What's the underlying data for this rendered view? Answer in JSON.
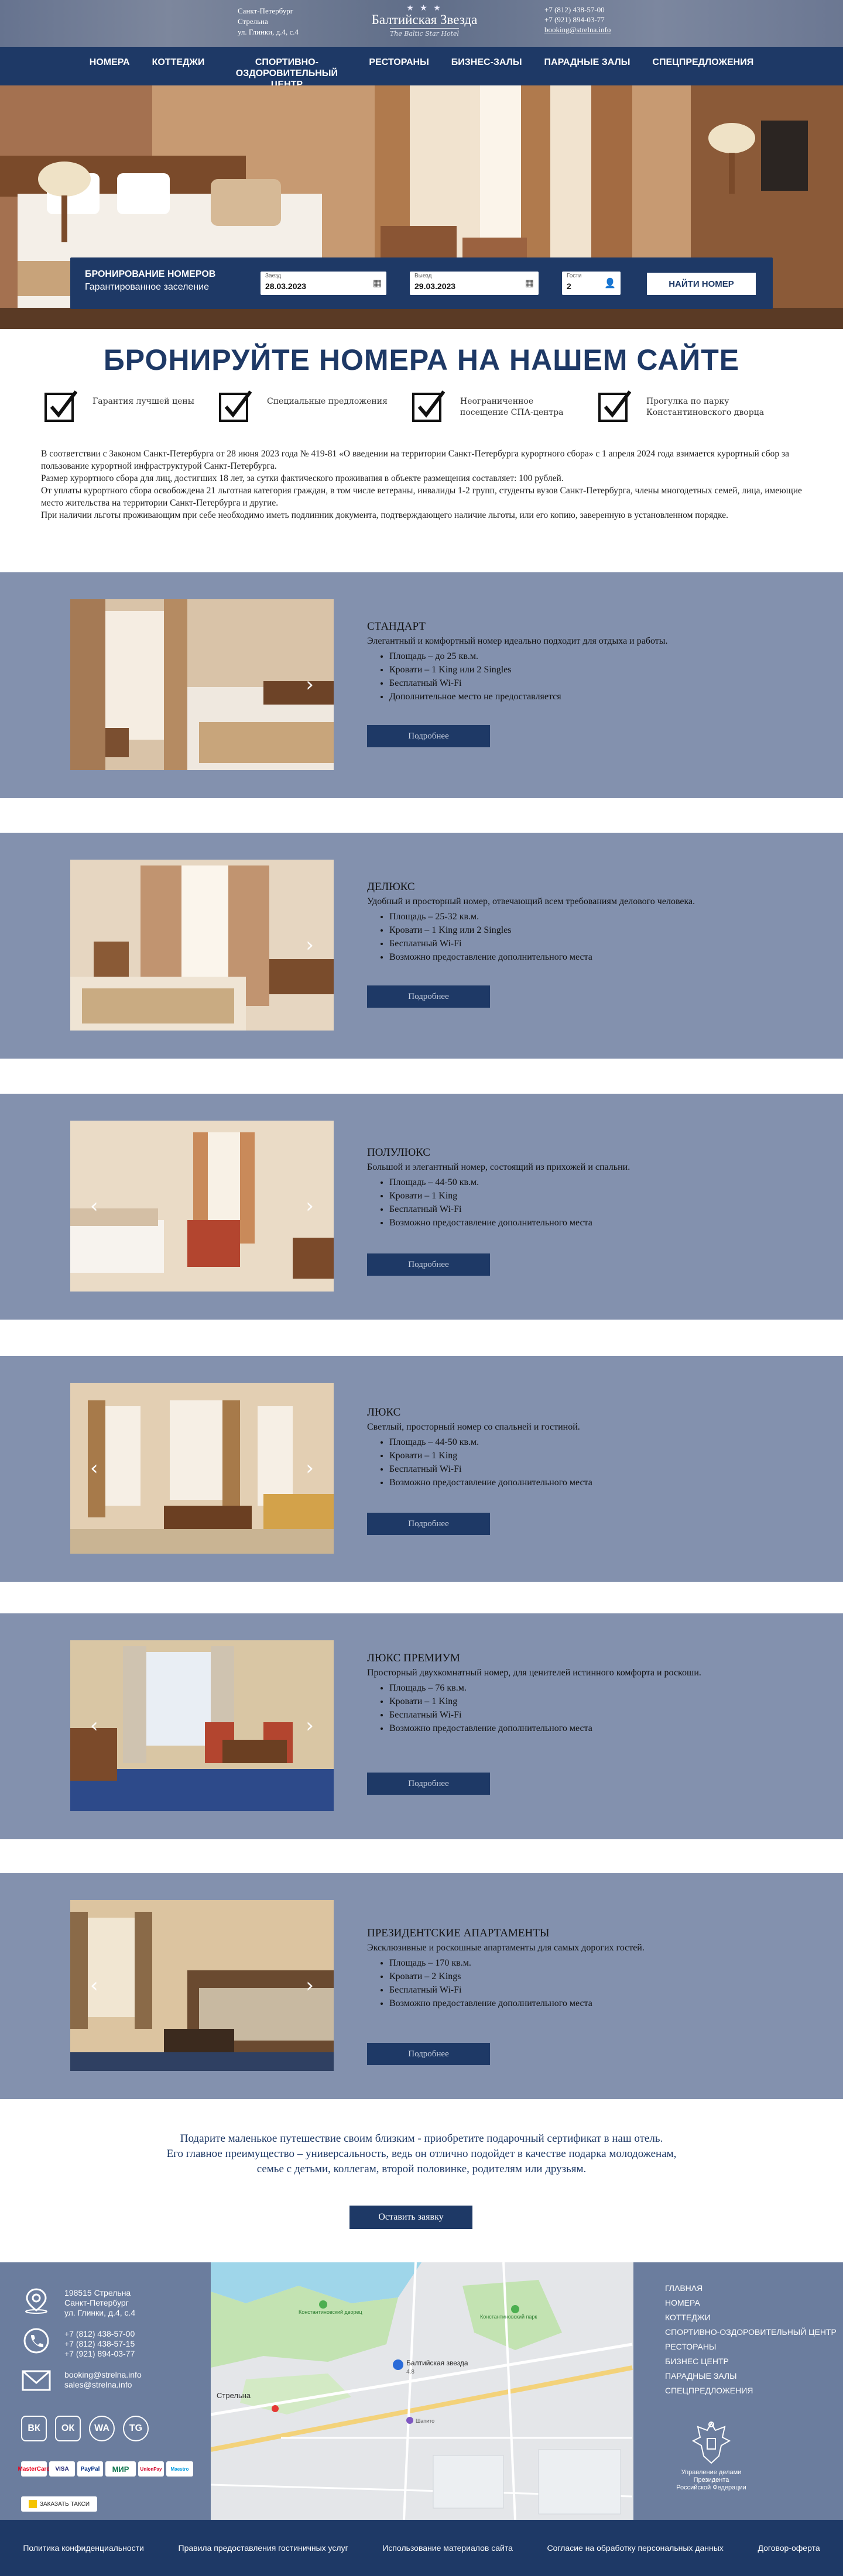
{
  "topbar": {
    "address_lines": [
      "Санкт-Петербург",
      "Стрельна",
      "ул. Глинки, д.4, с.4"
    ],
    "logo_name": "Балтийская Звезда",
    "logo_sub": "The Baltic Star Hotel",
    "phones": [
      "+7 (812) 438-57-00",
      "+7 (921) 894-03-77"
    ],
    "email": "booking@strelna.info"
  },
  "nav": {
    "items": [
      "НОМЕРА",
      "КОТТЕДЖИ",
      "СПОРТИВНО-ОЗДОРОВИТЕЛЬНЫЙ ЦЕНТР",
      "РЕСТОРАНЫ",
      "БИЗНЕС-ЗАЛЫ",
      "ПАРАДНЫЕ ЗАЛЫ",
      "СПЕЦПРЕДЛОЖЕНИЯ"
    ]
  },
  "booking": {
    "title": "БРОНИРОВАНИЕ НОМЕРОВ",
    "subtitle": "Гарантированное заселение",
    "checkin_label": "Заезд",
    "checkin_value": "28.03.2023",
    "checkout_label": "Выезд",
    "checkout_value": "29.03.2023",
    "guests_label": "Гости",
    "guests_value": "2",
    "button": "НАЙТИ НОМЕР"
  },
  "main": {
    "heading": "БРОНИРУЙТЕ НОМЕРА НА НАШЕМ САЙТЕ",
    "features": [
      {
        "label": "Гарантия лучшей цены"
      },
      {
        "label": "Специальные предложения"
      },
      {
        "label": "Неограниченное посещение СПА-центра"
      },
      {
        "label": "Прогулка по парку Константиновского дворца"
      }
    ],
    "notice": [
      "В соответствии с Законом Санкт-Петербурга от 28 июня 2023 года № 419-81 «О введении на территории Санкт-Петербурга курортного сбора» с 1 апреля 2024 года взимается курортный сбор за пользование курортной инфраструктурой Санкт-Петербурга.",
      "Размер курортного сбора для лиц, достигших 18 лет, за сутки фактического проживания в объекте размещения составляет: 100 рублей.",
      "От уплаты курортного сбора освобождена 21 льготная категория граждан, в том числе ветераны, инвалиды 1-2 групп, студенты вузов Санкт-Петербурга, члены многодетных семей, лица, имеющие место жительства на территории Санкт-Петербурга и другие.",
      "При наличии льготы проживающим при себе необходимо иметь подлинник документа, подтверждающего наличие льготы, или его копию, заверенную в установленном порядке."
    ]
  },
  "rooms": [
    {
      "title": "СТАНДАРТ",
      "desc": "Элегантный и комфортный номер идеально подходит для отдыха и работы.",
      "features": [
        "Площадь – до 25 кв.м.",
        "Кровати – 1 King или 2 Singles",
        "Бесплатный Wi-Fi",
        "Дополнительное место не предоставляется"
      ],
      "button": "Подробнее"
    },
    {
      "title": "ДЕЛЮКС",
      "desc": "Удобный и просторный номер, отвечающий всем требованиям делового человека.",
      "features": [
        "Площадь – 25-32 кв.м.",
        "Кровати – 1 King или 2 Singles",
        "Бесплатный Wi-Fi",
        "Возможно предоставление дополнительного места"
      ],
      "button": "Подробнее"
    },
    {
      "title": "ПОЛУЛЮКС",
      "desc": "Большой и элегантный номер, состоящий из прихожей и спальни.",
      "features": [
        "Площадь – 44-50 кв.м.",
        "Кровати – 1 King",
        "Бесплатный Wi-Fi",
        "Возможно предоставление дополнительного места"
      ],
      "button": "Подробнее"
    },
    {
      "title": "ЛЮКС",
      "desc": "Светлый, просторный номер со спальней и гостиной.",
      "features": [
        "Площадь – 44-50 кв.м.",
        "Кровати – 1 King",
        "Бесплатный Wi-Fi",
        "Возможно предоставление дополнительного места"
      ],
      "button": "Подробнее"
    },
    {
      "title": "ЛЮКС ПРЕМИУМ",
      "desc": "Просторный двухкомнатный номер, для ценителей истинного комфорта и роскоши.",
      "features": [
        "Площадь – 76 кв.м.",
        "Кровати – 1 King",
        "Бесплатный Wi-Fi",
        "Возможно предоставление дополнительного места"
      ],
      "button": "Подробнее"
    },
    {
      "title": "ПРЕЗИДЕНТСКИЕ АПАРТАМЕНТЫ",
      "desc": "Эксклюзивные и роскошные апартаменты для самых дорогих гостей.",
      "features": [
        "Площадь – 170 кв.м.",
        "Кровати – 2 Kings",
        "Бесплатный Wi-Fi",
        "Возможно предоставление дополнительного места"
      ],
      "button": "Подробнее"
    }
  ],
  "gift": {
    "line1": "Подарите маленькое путешествие своим близким - приобретите подарочный сертификат в наш отель.",
    "line2": "Его главное преимущество – универсальность, ведь он отлично подойдет в качестве подарка молодоженам,",
    "line3": "семье с детьми, коллегам, второй половинке, родителям или друзьям.",
    "button": "Оставить заявку"
  },
  "footer": {
    "address": [
      "198515 Стрельна",
      "Санкт-Петербург",
      "ул. Глинки, д.4, с.4"
    ],
    "phones": [
      "+7 (812) 438-57-00",
      "+7 (812) 438-57-15",
      "+7 (921) 894-03-77"
    ],
    "emails": [
      "booking@strelna.info",
      "sales@strelna.info"
    ],
    "social": [
      "ВК",
      "ОК",
      "WA",
      "TG"
    ],
    "payments": [
      "MasterCard",
      "VISA",
      "PayPal",
      "МИР",
      "UnionPay",
      "Maestro"
    ],
    "taxi": "ЗАКАЗАТЬ ТАКСИ",
    "nav": [
      "ГЛАВНАЯ",
      "НОМЕРА",
      "КОТТЕДЖИ",
      "СПОРТИВНО-ОЗДОРОВИТЕЛЬНЫЙ ЦЕНТР",
      "РЕСТОРАНЫ",
      "БИЗНЕС ЦЕНТР",
      "ПАРАДНЫЕ ЗАЛЫ",
      "СПЕЦПРЕДЛОЖЕНИЯ"
    ],
    "emblem": [
      "Управление делами",
      "Президента",
      "Российской Федерации"
    ],
    "map_labels": {
      "hotel": "Балтийская звезда",
      "hotel_rating": "4.8",
      "town": "Стрельна",
      "park": "Константиновский дворец",
      "place2": "Константиновский парк",
      "place3": "Шапито"
    }
  },
  "bottom_links": [
    "Политика конфиденциальности",
    "Правила предоставления гостиничных услуг",
    "Использование материалов сайта",
    "Согласие на обработку персональных данных",
    "Договор-оферта"
  ],
  "colors": {
    "brand": "#1e3966",
    "room_bg": "#8391ae",
    "footer_bg": "#6b7d9e"
  }
}
